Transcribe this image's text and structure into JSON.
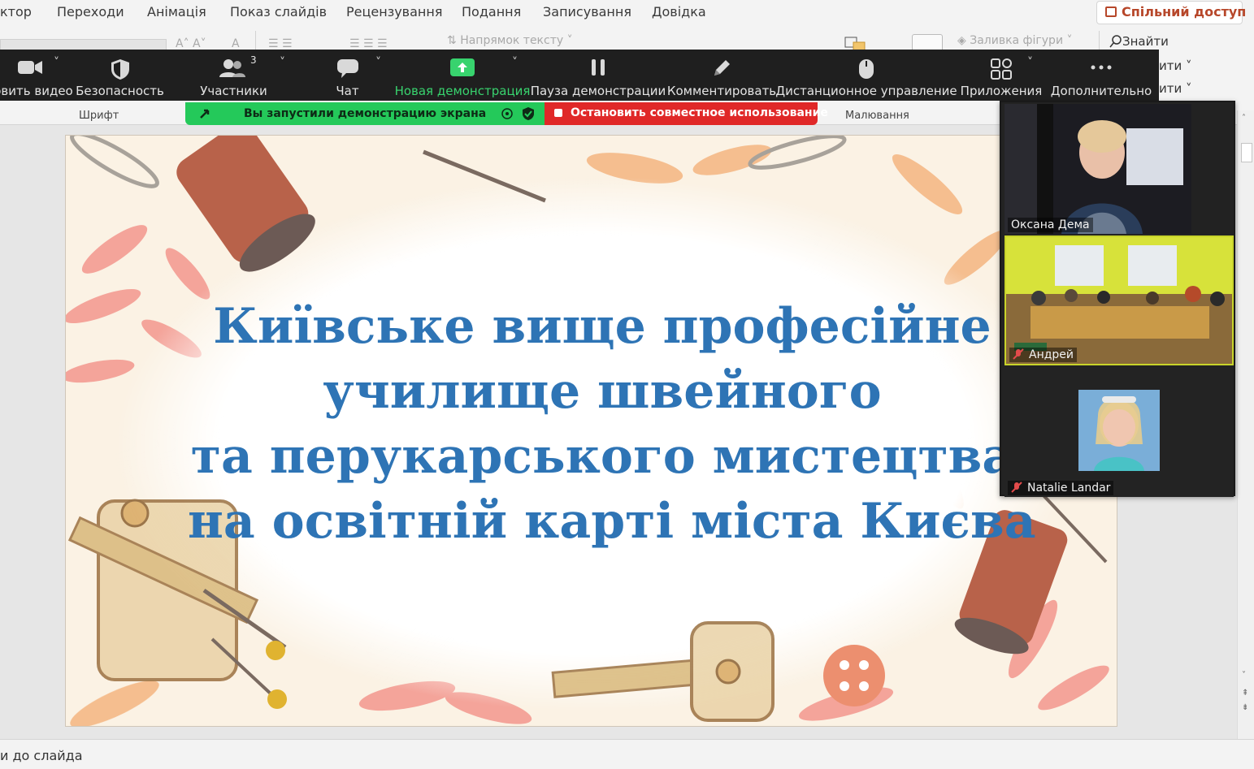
{
  "ppt": {
    "menu": [
      "ктор",
      "Переходи",
      "Анімація",
      "Показ слайдів",
      "Рецензування",
      "Подання",
      "Записування",
      "Довідка"
    ],
    "share_label": "Спільний доступ",
    "ribbon": {
      "text_direction": "Напрямок тексту",
      "shape_fill": "Заливка фігури",
      "find": "Знайти",
      "find_sub1": "ити",
      "find_sub2": "ити",
      "group_font": "Шрифт",
      "group_drawing": "Малювання"
    },
    "status_text": "и до слайда"
  },
  "zoom": {
    "toolbar": [
      {
        "label": "овить видео",
        "icon": "video-camera-icon"
      },
      {
        "label": "Безопасность",
        "icon": "shield-icon"
      },
      {
        "label": "Участники",
        "icon": "participants-icon",
        "badge": "3"
      },
      {
        "label": "Чат",
        "icon": "chat-bubble-icon"
      },
      {
        "label": "Новая демонстрация",
        "icon": "share-screen-icon"
      },
      {
        "label": "Пауза демонстрации",
        "icon": "pause-icon"
      },
      {
        "label": "Комментировать",
        "icon": "pencil-icon"
      },
      {
        "label": "Дистанционное управление",
        "icon": "mouse-icon"
      },
      {
        "label": "Приложения",
        "icon": "apps-icon"
      },
      {
        "label": "Дополнительно",
        "icon": "more-dots-icon"
      }
    ],
    "sharing_banner": "Вы запустили демонстрацию экрана",
    "stop_banner": "Остановить совместное использование",
    "participants": [
      {
        "name": "Оксана Дема",
        "muted": false
      },
      {
        "name": "Андрей",
        "muted": true
      },
      {
        "name": "Natalie Landar",
        "muted": true
      }
    ],
    "colors": {
      "active_green": "#38d36e",
      "banner_green": "#24c95a",
      "stop_red": "#e02828",
      "muted_red": "#e24b4b"
    }
  },
  "slide": {
    "title_lines": [
      "Київське вище професійне",
      "училище швейного",
      "та перукарського мистецтва",
      "на освітній карті міста Києва"
    ],
    "title_color": "#2e74b5"
  }
}
